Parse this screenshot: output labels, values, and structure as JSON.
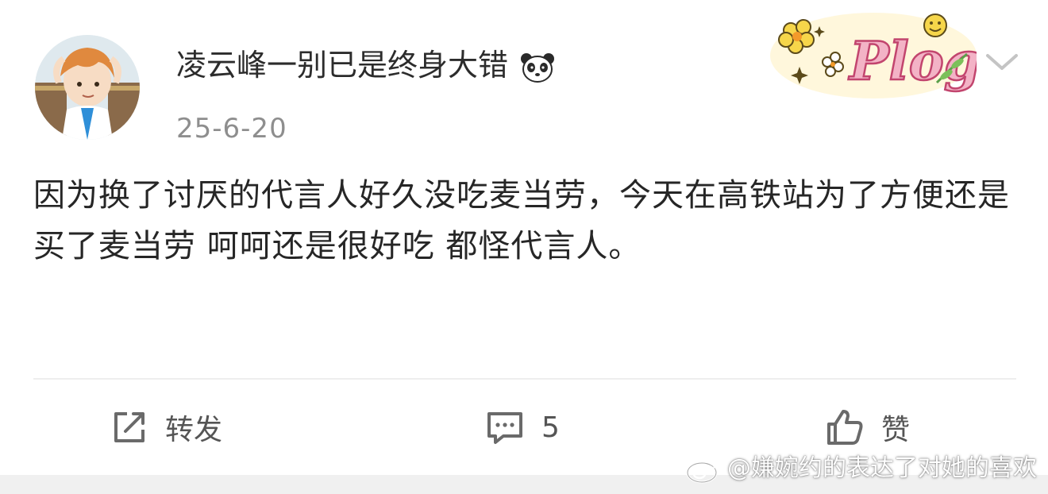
{
  "post": {
    "username": "凌云峰一别已是终身大错",
    "username_emoji": "panda-icon",
    "date": "25-6-20",
    "badge_text": "Plog",
    "body_text": "因为换了讨厌的代言人好久没吃麦当劳，今天在高铁站为了方便还是买了麦当劳 呵呵还是很好吃 都怪代言人。"
  },
  "actions": {
    "repost_label": "转发",
    "comment_count": "5",
    "like_label": "赞"
  },
  "watermark": {
    "text": "@嫌婉约的表达了对她的喜欢"
  },
  "colors": {
    "background": "#ffffff",
    "text_primary": "#262626",
    "text_secondary": "#8e8e8e",
    "badge_pink": "#e05a8a",
    "badge_yellow": "#f6d64a"
  }
}
